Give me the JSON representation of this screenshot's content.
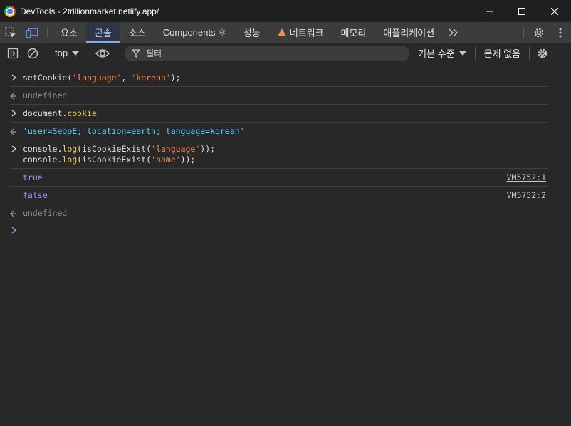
{
  "window": {
    "title": "DevTools - 2trillionmarket.netlify.app/"
  },
  "tabs": [
    {
      "label": "요소"
    },
    {
      "label": "콘솔"
    },
    {
      "label": "소스"
    },
    {
      "label": "Components ⚛"
    },
    {
      "label": "성능"
    },
    {
      "label": "네트워크"
    },
    {
      "label": "메모리"
    },
    {
      "label": "애플리케이션"
    }
  ],
  "toolbar": {
    "context": "top",
    "filter_placeholder": "필터",
    "level": "기본 수준",
    "issues": "문제 없음"
  },
  "console": {
    "entries": [
      {
        "type": "input",
        "parts": [
          "setCookie(",
          "'language'",
          ", ",
          "'korean'",
          ");"
        ]
      },
      {
        "type": "result",
        "text": "undefined"
      },
      {
        "type": "input",
        "parts": [
          "document.",
          "cookie"
        ]
      },
      {
        "type": "result",
        "text": "'user=SeopE; location=earth; language=korean'"
      },
      {
        "type": "input",
        "line1": [
          "console.",
          "log",
          "(isCookieExist(",
          "'language'",
          "));"
        ],
        "line2": [
          "console.",
          "log",
          "(isCookieExist(",
          "'name'",
          "));"
        ]
      },
      {
        "type": "log",
        "text": "true",
        "source": "VM5752:1"
      },
      {
        "type": "log",
        "text": "false",
        "source": "VM5752:2"
      },
      {
        "type": "result",
        "text": "undefined"
      }
    ]
  },
  "colors": {
    "accent": "#7cacf8",
    "string": "#f28b54",
    "property": "#f2c94c",
    "boolean": "#9a9aff"
  }
}
